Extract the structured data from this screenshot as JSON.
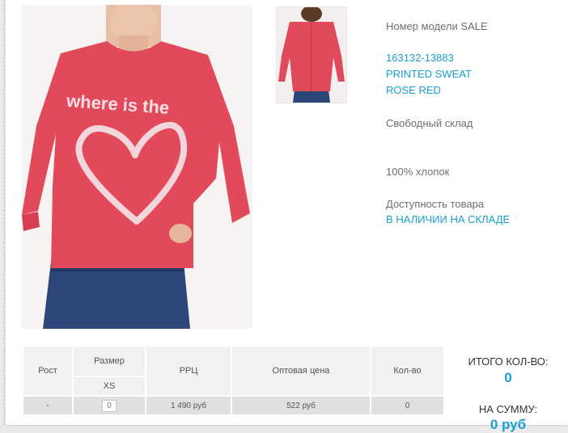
{
  "product": {
    "model_label": "Номер модели SALE",
    "article": "163132-13883",
    "name": "PRINTED SWEAT",
    "color": "ROSE RED",
    "fit": "Свободный склад",
    "material": "100% хлопок",
    "availability_label": "Доступность товара",
    "availability_value": "В НАЛИЧИИ НА СКЛАДЕ",
    "print_text": "where is the"
  },
  "order_table": {
    "col_height": "Рост",
    "col_size": "Размер",
    "size_option": "XS",
    "col_rrc": "РРЦ",
    "col_wholesale": "Оптовая цена",
    "col_qty": "Кол-во",
    "row": {
      "height": "-",
      "size_qty": "0",
      "rrc": "1 490 руб",
      "wholesale": "522 руб",
      "qty": "0"
    }
  },
  "totals": {
    "qty_label": "ИТОГО КОЛ-ВО:",
    "qty_value": "0",
    "sum_label": "НА СУММУ:",
    "sum_value": "0 руб"
  },
  "colors": {
    "accent": "#1a9fd0",
    "garment": "#e4485a"
  }
}
